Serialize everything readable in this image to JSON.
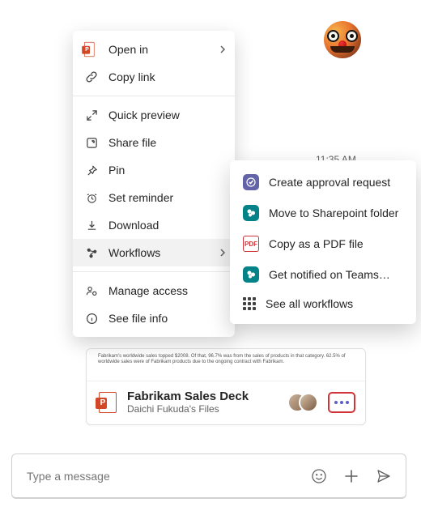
{
  "timestamp": "11:35 AM",
  "file_card": {
    "title": "Fabrikam Sales Deck",
    "subtitle": "Daichi Fukuda's Files",
    "preview_text": "Fabrikam's worldwide sales topped $2008. Of that, 96.7% was from the sales of products in that category. 62.5% of worldwide sales were of Fabrikam products due to the ongoing contract with Fabrikam."
  },
  "menu": {
    "open_in": "Open in",
    "copy_link": "Copy link",
    "quick_preview": "Quick preview",
    "share_file": "Share file",
    "pin": "Pin",
    "set_reminder": "Set reminder",
    "download": "Download",
    "workflows": "Workflows",
    "manage_access": "Manage access",
    "see_file_info": "See file info"
  },
  "submenu": {
    "create_approval": "Create approval request",
    "move_sharepoint": "Move to Sharepoint folder",
    "copy_pdf": "Copy as a PDF file",
    "notified_teams": "Get notified on Teams…",
    "see_all": "See all workflows"
  },
  "compose": {
    "placeholder": "Type a message"
  }
}
